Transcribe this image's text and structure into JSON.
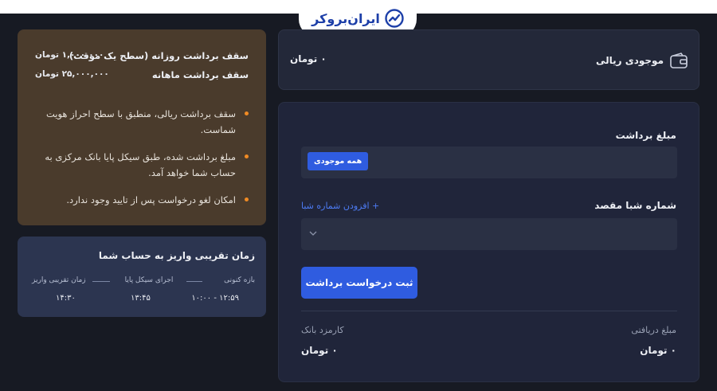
{
  "brand": {
    "logo_text": "ایران‌بروکر"
  },
  "balance": {
    "label": "موجودی ریالی",
    "value": "۰ تومان"
  },
  "form": {
    "amount_label": "مبلغ برداشت",
    "all_balance_chip": "همه موجودی",
    "sheba_label": "شماره شبا مقصد",
    "add_sheba_link": "+ افزودن شماره شبا",
    "submit_label": "ثبت درخواست برداشت",
    "received_label": "مبلغ دریافتی",
    "received_value": "۰ تومان",
    "fee_label": "کارمزد بانک",
    "fee_value": "۰ تومان"
  },
  "limits": {
    "daily_label": "سقف برداشت روزانه (سطح یک موقت)",
    "daily_value": "۱,۰۰۰,۰۰۰ تومان",
    "monthly_label": "سقف برداشت ماهانه",
    "monthly_value": "۲۵,۰۰۰,۰۰۰ تومان",
    "notes": [
      "سقف برداشت ریالی، منطبق با سطح احراز هویت شماست.",
      "مبلغ برداشت شده، طبق سیکل پایا بانک مرکزی به حساب شما خواهد آمد.",
      "امکان لغو درخواست پس از تایید وجود ندارد."
    ]
  },
  "timing": {
    "title": "زمان تقریبی واریز به حساب شما",
    "steps": [
      {
        "label": "بازه کنونی",
        "value": "۱۲:۵۹ - ۱۰:۰۰"
      },
      {
        "label": "اجرای سیکل پایا",
        "value": "۱۳:۴۵"
      },
      {
        "label": "زمان تقریبی واریز",
        "value": "۱۴:۳۰"
      }
    ]
  },
  "colors": {
    "accent": "#2f5ce0",
    "bullet": "#f08a24",
    "brand": "#1d3fa8"
  }
}
